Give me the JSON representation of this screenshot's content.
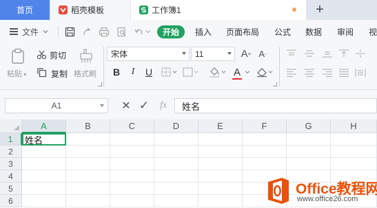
{
  "tabs": {
    "home": "首页",
    "daoke": "稻壳模板",
    "book": "工作簿1",
    "new_tab": "+"
  },
  "menu": {
    "file": "文件",
    "items": [
      "开始",
      "插入",
      "页面布局",
      "公式",
      "数据",
      "审阅",
      "视"
    ]
  },
  "ribbon": {
    "paste": "粘贴",
    "cut": "剪切",
    "copy": "复制",
    "format_painter": "格式刷",
    "font_name": "宋体",
    "font_size": "11",
    "bold": "B",
    "italic": "I",
    "underline": "U",
    "increase_font": "A",
    "decrease_font": "A",
    "font_color": "A"
  },
  "formula_bar": {
    "name_box": "A1",
    "cancel": "✕",
    "confirm": "✓",
    "fx": "fx",
    "content": "姓名"
  },
  "grid": {
    "columns": [
      "A",
      "B",
      "C",
      "D",
      "E",
      "F",
      "G",
      "H"
    ],
    "rows": [
      "1",
      "2",
      "3",
      "4",
      "5",
      "6"
    ],
    "cells": {
      "A1": "姓名"
    },
    "active_cell": "A1"
  },
  "watermark": {
    "title": "Office教程网",
    "url": "www.office26.com"
  },
  "colors": {
    "accent": "#20a162",
    "home_tab": "#4f84e8",
    "watermark": "#e8520a"
  }
}
